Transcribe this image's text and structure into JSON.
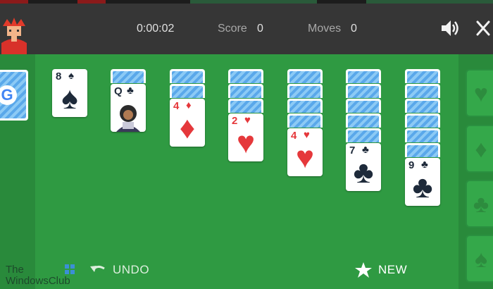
{
  "header": {
    "timer": "0:00:02",
    "score_label": "Score",
    "score_value": "0",
    "moves_label": "Moves",
    "moves_value": "0",
    "sound_icon": "speaker-icon",
    "close_icon": "close-icon"
  },
  "tableau": [
    {
      "facedown": 0,
      "rank": "8",
      "suit": "♠",
      "color": "black",
      "face_image": false
    },
    {
      "facedown": 1,
      "rank": "Q",
      "suit": "♣",
      "color": "black",
      "face_image": true
    },
    {
      "facedown": 2,
      "rank": "4",
      "suit": "♦",
      "color": "red",
      "face_image": false
    },
    {
      "facedown": 3,
      "rank": "2",
      "suit": "♥",
      "color": "red",
      "face_image": false
    },
    {
      "facedown": 4,
      "rank": "4",
      "suit": "♥",
      "color": "red",
      "face_image": false
    },
    {
      "facedown": 5,
      "rank": "7",
      "suit": "♣",
      "color": "black",
      "face_image": false
    },
    {
      "facedown": 6,
      "rank": "9",
      "suit": "♣",
      "color": "black",
      "face_image": false
    }
  ],
  "stock": {
    "logo": "G"
  },
  "foundations": [
    {
      "suit": "♥",
      "icon": "heart-icon"
    },
    {
      "suit": "♦",
      "icon": "diamond-icon"
    },
    {
      "suit": "♣",
      "icon": "club-icon"
    },
    {
      "suit": "♠",
      "icon": "spade-icon"
    }
  ],
  "actions": {
    "undo_label": "UNDO",
    "new_label": "NEW"
  },
  "watermark": {
    "line1": "The",
    "line2": "WindowsClub"
  },
  "colors": {
    "board": "#2f9a42",
    "header": "#363636",
    "red_suit": "#e5383b",
    "black_suit": "#1e2a3a",
    "card_back": "#5aa8ea"
  }
}
